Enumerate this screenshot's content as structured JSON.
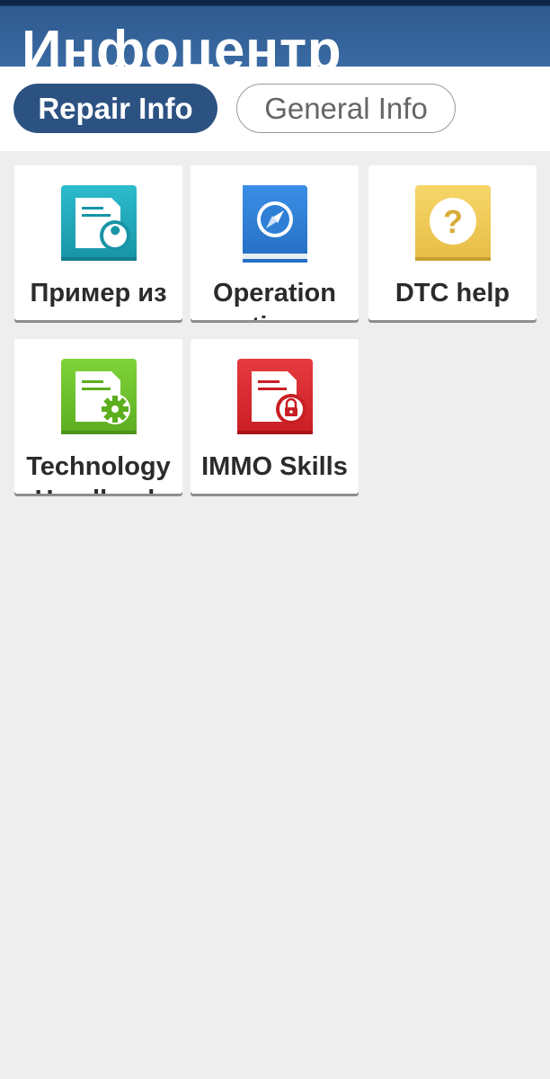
{
  "header": {
    "title": "Инфоцентр"
  },
  "tabs": [
    {
      "label": "Repair Info",
      "active": true
    },
    {
      "label": "General Info",
      "active": false
    }
  ],
  "tiles": [
    {
      "label": "Пример из практики",
      "icon": "document-wrench-icon",
      "color": "#1fa6b8"
    },
    {
      "label": "Operation tips",
      "icon": "compass-book-icon",
      "color": "#2f7fd6"
    },
    {
      "label": "DTC help",
      "icon": "question-mark-icon",
      "color": "#f0cc5a"
    },
    {
      "label": "Technology Handbook",
      "icon": "document-gear-icon",
      "color": "#6ec22a"
    },
    {
      "label": "IMMO Skills",
      "icon": "document-lock-icon",
      "color": "#d9262b"
    }
  ],
  "colors": {
    "header_bg": "#3a6aa3",
    "tab_active_bg": "#2c5282",
    "page_bg": "#eeeeee"
  }
}
